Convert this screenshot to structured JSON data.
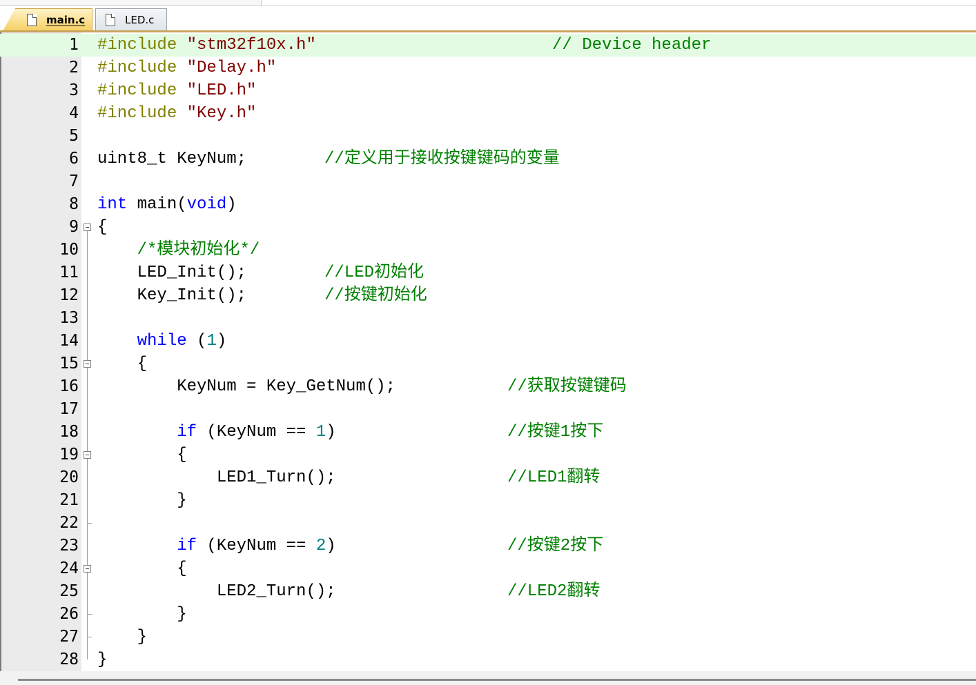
{
  "tabs": [
    {
      "label": "main.c",
      "active": true
    },
    {
      "label": "LED.c",
      "active": false
    }
  ],
  "colors": {
    "active_tab": "#f6cf63",
    "current_line": "#e2fbe2",
    "comment": "#008000",
    "keyword": "#0000ff",
    "preprocessor": "#808000",
    "string": "#800000",
    "number": "#008080"
  },
  "lines": [
    {
      "n": "1",
      "code": "#include \"stm32f10x.h\"",
      "comment": "// Device header"
    },
    {
      "n": "2",
      "code": "#include \"Delay.h\"",
      "comment": ""
    },
    {
      "n": "3",
      "code": "#include \"LED.h\"",
      "comment": ""
    },
    {
      "n": "4",
      "code": "#include \"Key.h\"",
      "comment": ""
    },
    {
      "n": "5",
      "code": "",
      "comment": ""
    },
    {
      "n": "6",
      "code": "uint8_t KeyNum;",
      "comment": "//定义用于接收按键键码的变量"
    },
    {
      "n": "7",
      "code": "",
      "comment": ""
    },
    {
      "n": "8",
      "code": "int main(void)",
      "comment": ""
    },
    {
      "n": "9",
      "code": "{",
      "comment": ""
    },
    {
      "n": "10",
      "code": "    /*模块初始化*/",
      "comment": ""
    },
    {
      "n": "11",
      "code": "    LED_Init();",
      "comment": "//LED初始化"
    },
    {
      "n": "12",
      "code": "    Key_Init();",
      "comment": "//按键初始化"
    },
    {
      "n": "13",
      "code": "",
      "comment": ""
    },
    {
      "n": "14",
      "code": "    while (1)",
      "comment": ""
    },
    {
      "n": "15",
      "code": "    {",
      "comment": ""
    },
    {
      "n": "16",
      "code": "        KeyNum = Key_GetNum();",
      "comment": "//获取按键键码"
    },
    {
      "n": "17",
      "code": "",
      "comment": ""
    },
    {
      "n": "18",
      "code": "        if (KeyNum == 1)",
      "comment": "//按键1按下"
    },
    {
      "n": "19",
      "code": "        {",
      "comment": ""
    },
    {
      "n": "20",
      "code": "            LED1_Turn();",
      "comment": "//LED1翻转"
    },
    {
      "n": "21",
      "code": "        }",
      "comment": ""
    },
    {
      "n": "22",
      "code": "",
      "comment": ""
    },
    {
      "n": "23",
      "code": "        if (KeyNum == 2)",
      "comment": "//按键2按下"
    },
    {
      "n": "24",
      "code": "        {",
      "comment": ""
    },
    {
      "n": "25",
      "code": "            LED2_Turn();",
      "comment": "//LED2翻转"
    },
    {
      "n": "26",
      "code": "        }",
      "comment": ""
    },
    {
      "n": "27",
      "code": "    }",
      "comment": ""
    },
    {
      "n": "28",
      "code": "}",
      "comment": ""
    }
  ]
}
